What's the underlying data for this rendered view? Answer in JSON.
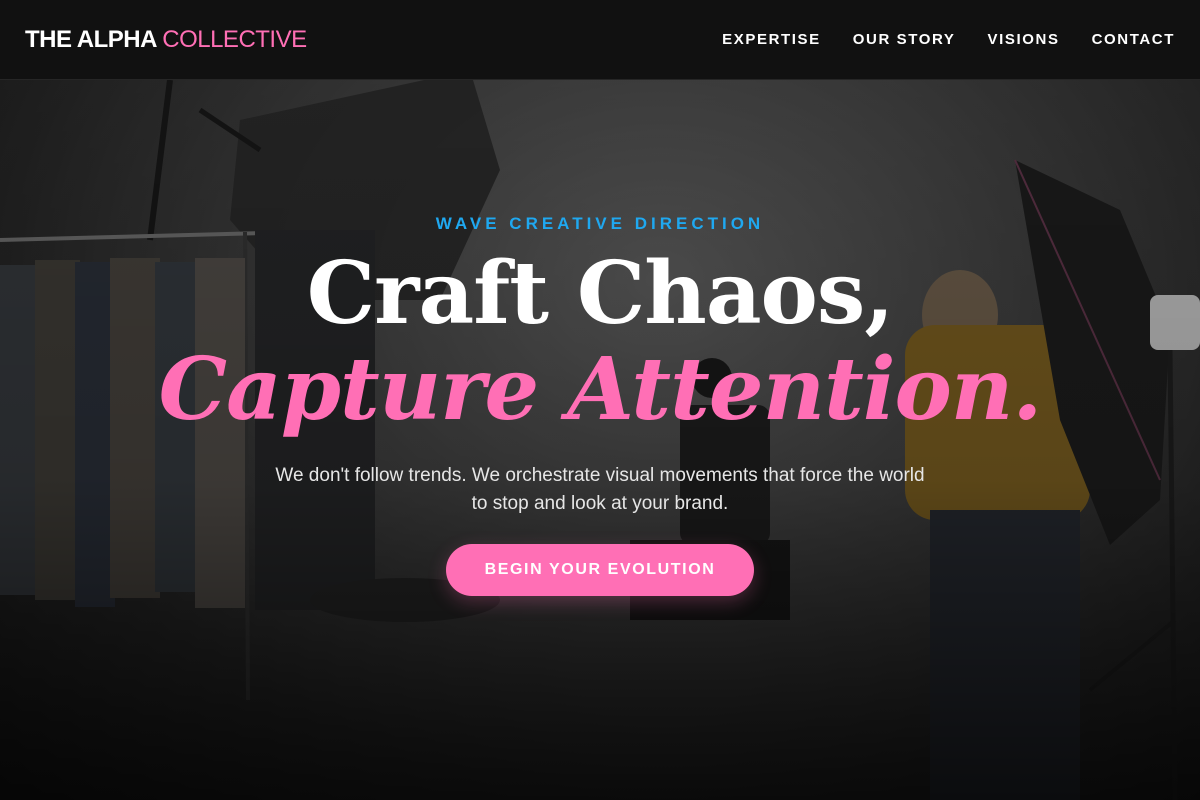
{
  "brand": {
    "name_primary": "THE ALPHA",
    "name_accent": "COLLECTIVE",
    "accent_color": "#ff6fb5"
  },
  "nav": {
    "items": [
      {
        "label": "EXPERTISE"
      },
      {
        "label": "OUR STORY"
      },
      {
        "label": "VISIONS"
      },
      {
        "label": "CONTACT"
      }
    ]
  },
  "hero": {
    "eyebrow": "WAVE CREATIVE DIRECTION",
    "eyebrow_color": "#1fa8f0",
    "headline_line1": "Craft Chaos,",
    "headline_line2": "Capture Attention.",
    "subtext": "We don't follow trends. We orchestrate visual movements that force the world to stop and look at your brand.",
    "cta_label": "BEGIN YOUR EVOLUTION",
    "background": "photo studio scene"
  }
}
